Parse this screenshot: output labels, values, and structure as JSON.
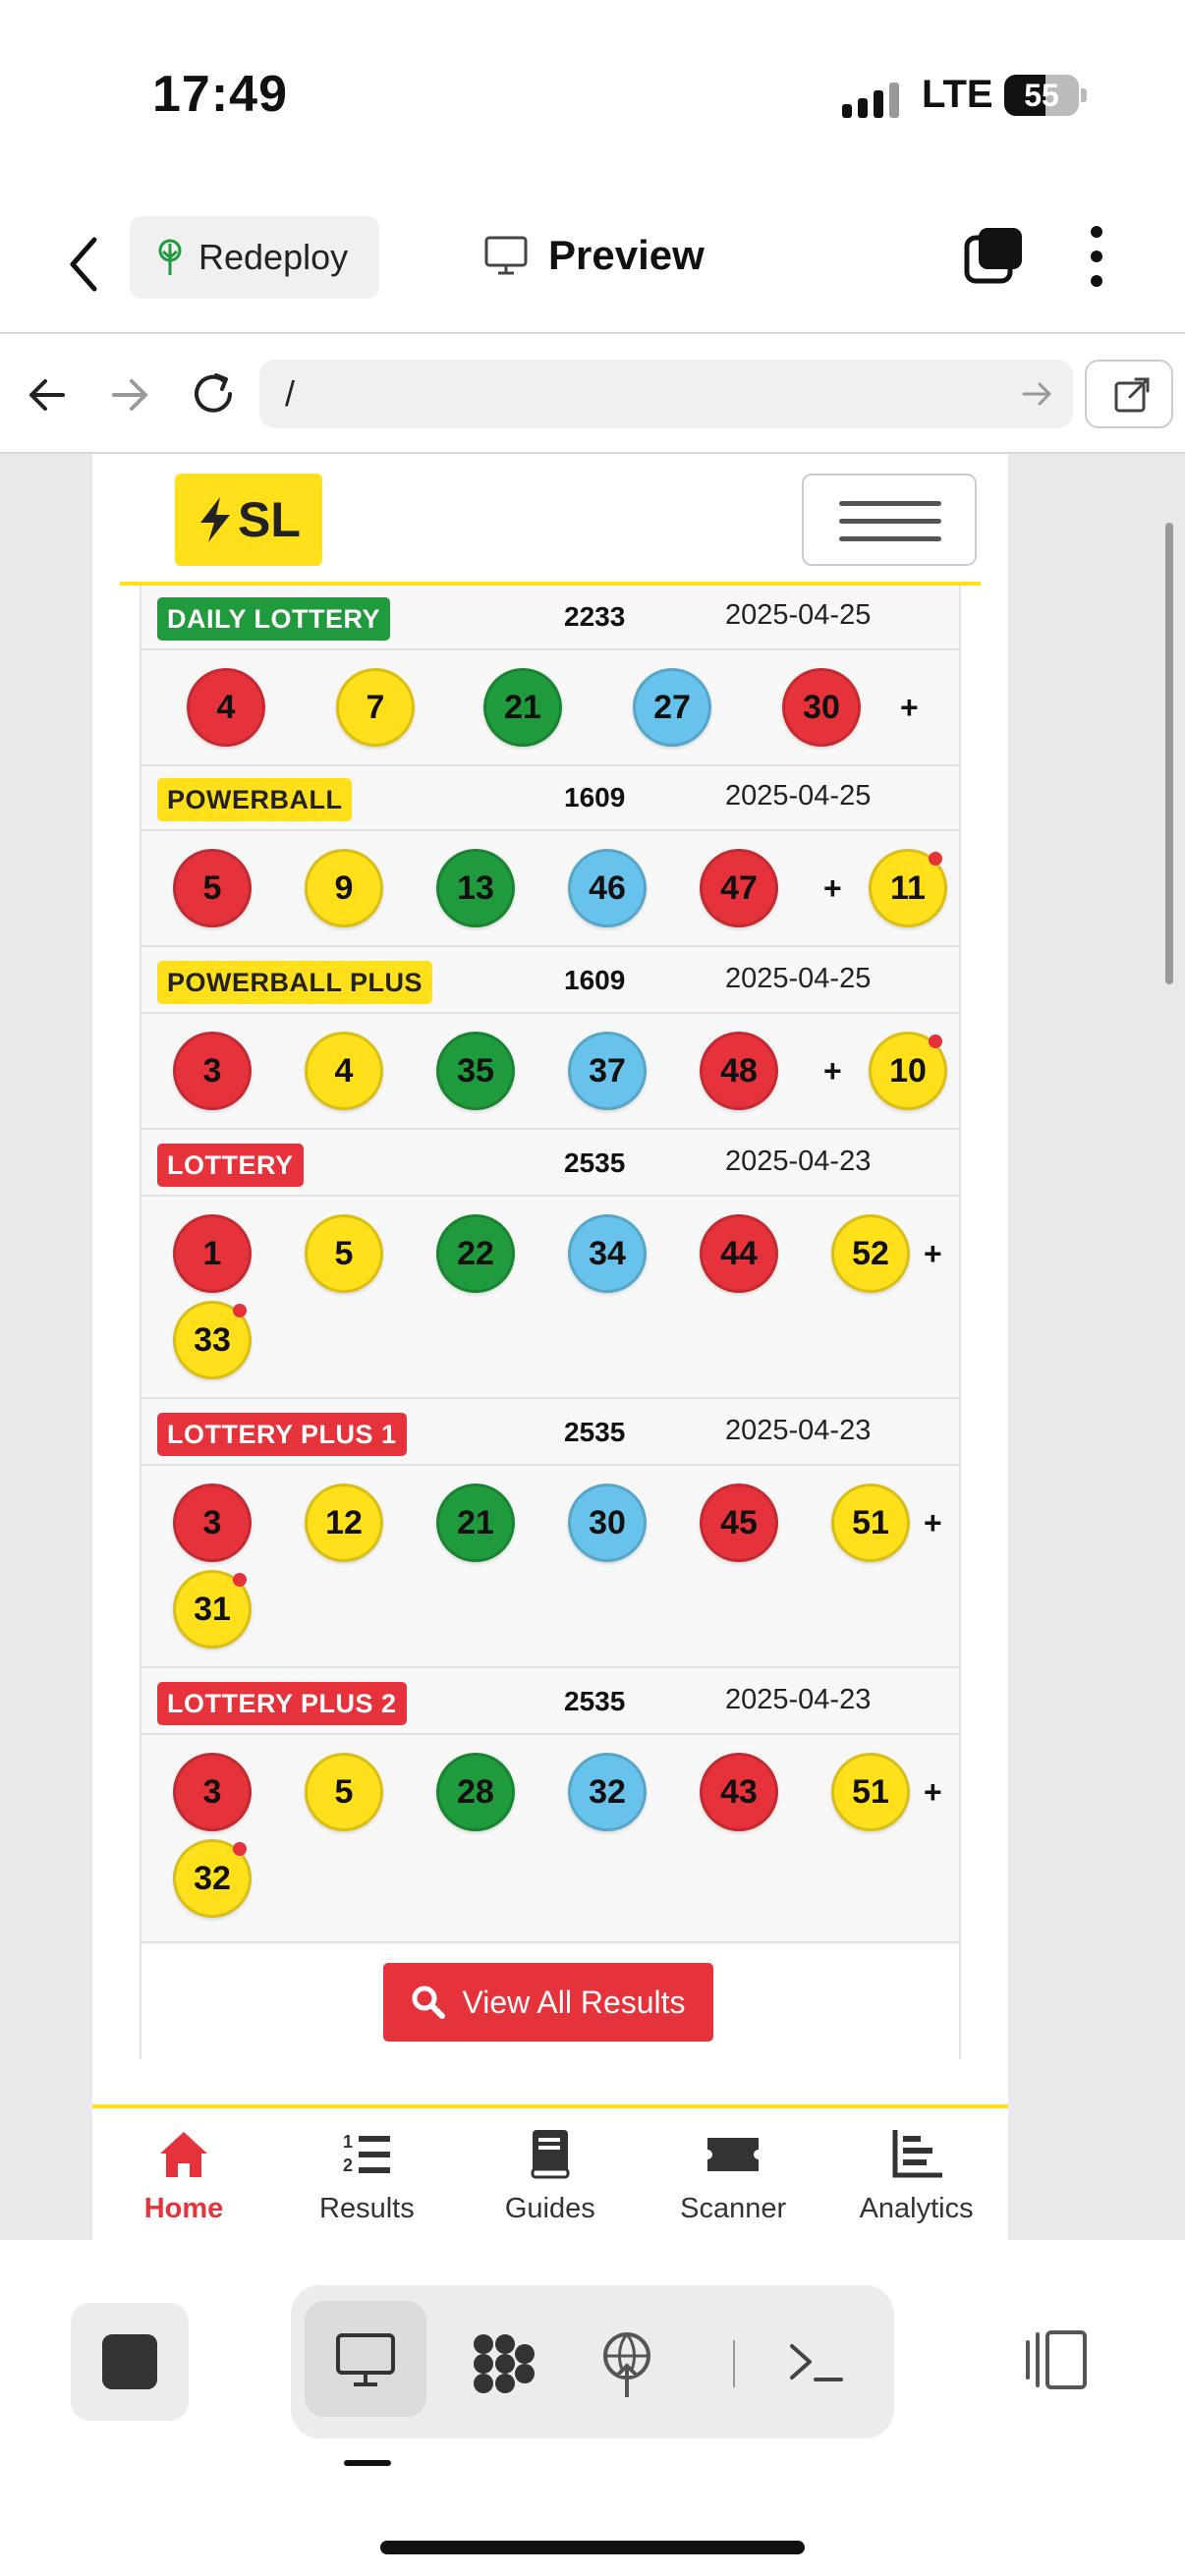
{
  "status_bar": {
    "time": "17:49",
    "network": "LTE",
    "battery": "55",
    "battery_level": 0.55
  },
  "app_bar": {
    "redeploy_label": "Redeploy",
    "preview_label": "Preview"
  },
  "url_bar": {
    "url": "/"
  },
  "site": {
    "logo_text": "SL"
  },
  "results": [
    {
      "name": "DAILY LOTTERY",
      "badge_color": "#1f9a3c",
      "badge_text_color": "#ffffff",
      "draw": "2233",
      "date": "2025-04-25",
      "balls": [
        {
          "n": "4",
          "c": "red"
        },
        {
          "n": "7",
          "c": "yellow"
        },
        {
          "n": "21",
          "c": "green"
        },
        {
          "n": "27",
          "c": "blue"
        },
        {
          "n": "30",
          "c": "red"
        }
      ],
      "bonus": null
    },
    {
      "name": "POWERBALL",
      "badge_color": "#ffe01b",
      "badge_text_color": "#222222",
      "draw": "1609",
      "date": "2025-04-25",
      "balls": [
        {
          "n": "5",
          "c": "red"
        },
        {
          "n": "9",
          "c": "yellow"
        },
        {
          "n": "13",
          "c": "green"
        },
        {
          "n": "46",
          "c": "blue"
        },
        {
          "n": "47",
          "c": "red"
        }
      ],
      "bonus": "11"
    },
    {
      "name": "POWERBALL PLUS",
      "badge_color": "#ffe01b",
      "badge_text_color": "#222222",
      "draw": "1609",
      "date": "2025-04-25",
      "balls": [
        {
          "n": "3",
          "c": "red"
        },
        {
          "n": "4",
          "c": "yellow"
        },
        {
          "n": "35",
          "c": "green"
        },
        {
          "n": "37",
          "c": "blue"
        },
        {
          "n": "48",
          "c": "red"
        }
      ],
      "bonus": "10"
    },
    {
      "name": "LOTTERY",
      "badge_color": "#e5323b",
      "badge_text_color": "#ffffff",
      "draw": "2535",
      "date": "2025-04-23",
      "balls": [
        {
          "n": "1",
          "c": "red"
        },
        {
          "n": "5",
          "c": "yellow"
        },
        {
          "n": "22",
          "c": "green"
        },
        {
          "n": "34",
          "c": "blue"
        },
        {
          "n": "44",
          "c": "red"
        },
        {
          "n": "52",
          "c": "yellow"
        }
      ],
      "bonus": "33"
    },
    {
      "name": "LOTTERY PLUS 1",
      "badge_color": "#e5323b",
      "badge_text_color": "#ffffff",
      "draw": "2535",
      "date": "2025-04-23",
      "balls": [
        {
          "n": "3",
          "c": "red"
        },
        {
          "n": "12",
          "c": "yellow"
        },
        {
          "n": "21",
          "c": "green"
        },
        {
          "n": "30",
          "c": "blue"
        },
        {
          "n": "45",
          "c": "red"
        },
        {
          "n": "51",
          "c": "yellow"
        }
      ],
      "bonus": "31"
    },
    {
      "name": "LOTTERY PLUS 2",
      "badge_color": "#e5323b",
      "badge_text_color": "#ffffff",
      "draw": "2535",
      "date": "2025-04-23",
      "balls": [
        {
          "n": "3",
          "c": "red"
        },
        {
          "n": "5",
          "c": "yellow"
        },
        {
          "n": "28",
          "c": "green"
        },
        {
          "n": "32",
          "c": "blue"
        },
        {
          "n": "43",
          "c": "red"
        },
        {
          "n": "51",
          "c": "yellow"
        }
      ],
      "bonus": "32"
    }
  ],
  "view_all_label": "View All Results",
  "bottom_nav": [
    {
      "label": "Home",
      "icon": "home-icon",
      "active": true
    },
    {
      "label": "Results",
      "icon": "ordered-list-icon",
      "active": false
    },
    {
      "label": "Guides",
      "icon": "book-icon",
      "active": false
    },
    {
      "label": "Scanner",
      "icon": "ticket-icon",
      "active": false
    },
    {
      "label": "Analytics",
      "icon": "bar-chart-icon",
      "active": false
    }
  ],
  "colors": {
    "accent_red": "#e5323b",
    "accent_yellow": "#ffe01b",
    "green": "#1f9a3c",
    "blue": "#67c3ec"
  }
}
